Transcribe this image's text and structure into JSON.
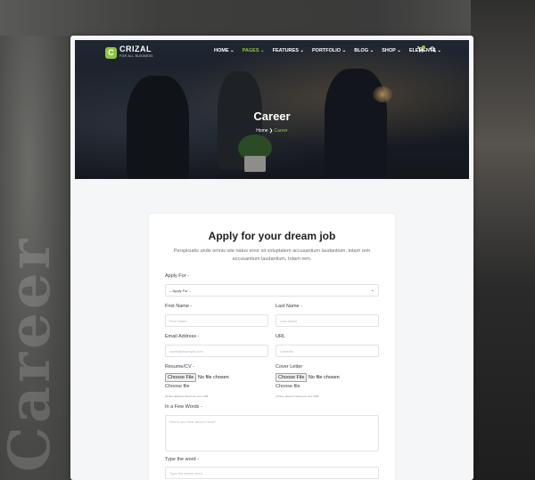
{
  "background": {
    "side_word": "Career"
  },
  "brand": {
    "name": "CRIZAL",
    "tagline": "FOR ALL BUSINESS",
    "accent": "#8dc63f",
    "mark": "C"
  },
  "nav": {
    "items": [
      {
        "label": "HOME ⌄"
      },
      {
        "label": "PAGES ⌄"
      },
      {
        "label": "FEATURES ⌄"
      },
      {
        "label": "PORTFOLIO ⌄"
      },
      {
        "label": "BLOG ⌄"
      },
      {
        "label": "SHOP ⌄"
      },
      {
        "label": "ELEMENTS ⌄"
      }
    ],
    "cart_icon": "cart-icon",
    "search_icon": "search-icon"
  },
  "hero": {
    "title": "Career",
    "breadcrumb": {
      "home": "Home",
      "separator": "❯",
      "current": "Career"
    }
  },
  "form": {
    "title": "Apply for your dream job",
    "description": "Perspiciatis unde omnis iste natus error sit voluptatem accusantium laudantium, totam rem accusantium laudantium, totam rem.",
    "apply_for": {
      "label": "Apply For -",
      "value": "-- Apply For --"
    },
    "first_name": {
      "label": "First Name -",
      "placeholder": "First Name"
    },
    "last_name": {
      "label": "Last Name -",
      "placeholder": "Last Name"
    },
    "email": {
      "label": "Email Address -",
      "placeholder": "name@example.com"
    },
    "url": {
      "label": "URL",
      "placeholder": "LinkedIn"
    },
    "resume": {
      "label": "Resume/CV -",
      "button": "Choose File",
      "status": "No file chosen",
      "choose": "Choose file",
      "hint": "All files allowed. Maximum size 1MB"
    },
    "cover": {
      "label": "Cover Letter",
      "button": "Choose File",
      "status": "No file chosen",
      "choose": "Choose file",
      "hint": "All files allowed. Maximum size 1MB"
    },
    "words": {
      "label": "In a Few Words -",
      "placeholder": "How'd you hear about Crizal?"
    },
    "type_word": {
      "label": "Type the word -",
      "placeholder": "Type the below word"
    }
  }
}
